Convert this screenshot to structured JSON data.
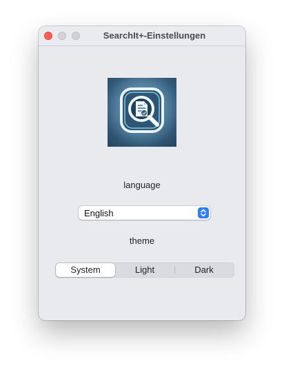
{
  "window": {
    "title": "SearchIt+-Einstellungen"
  },
  "app_icon": {
    "name": "search-document-app-icon"
  },
  "language": {
    "label": "language",
    "selected": "English"
  },
  "theme": {
    "label": "theme",
    "options": [
      "System",
      "Light",
      "Dark"
    ],
    "selected": "System"
  },
  "colors": {
    "close": "#fe5f57",
    "accent": "#2c7ff6",
    "window_bg": "#e8eaee"
  }
}
